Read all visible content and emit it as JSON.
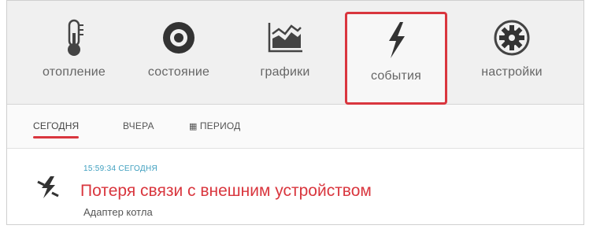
{
  "nav": {
    "items": [
      {
        "label": "отопление",
        "icon": "thermometer-icon"
      },
      {
        "label": "состояние",
        "icon": "target-icon"
      },
      {
        "label": "графики",
        "icon": "chart-icon"
      },
      {
        "label": "события",
        "icon": "lightning-icon",
        "active": true
      },
      {
        "label": "настройки",
        "icon": "gear-icon"
      }
    ]
  },
  "tabs": [
    {
      "label": "сегодня",
      "active": true
    },
    {
      "label": "вчера"
    },
    {
      "label": "период"
    }
  ],
  "event": {
    "time": "15:59:34 СЕГОДНЯ",
    "title": "Потеря связи с внешним устройством",
    "source": "Адаптер котла"
  },
  "colors": {
    "accent": "#d9363e",
    "time": "#3e9fbf",
    "icon": "#333333"
  }
}
